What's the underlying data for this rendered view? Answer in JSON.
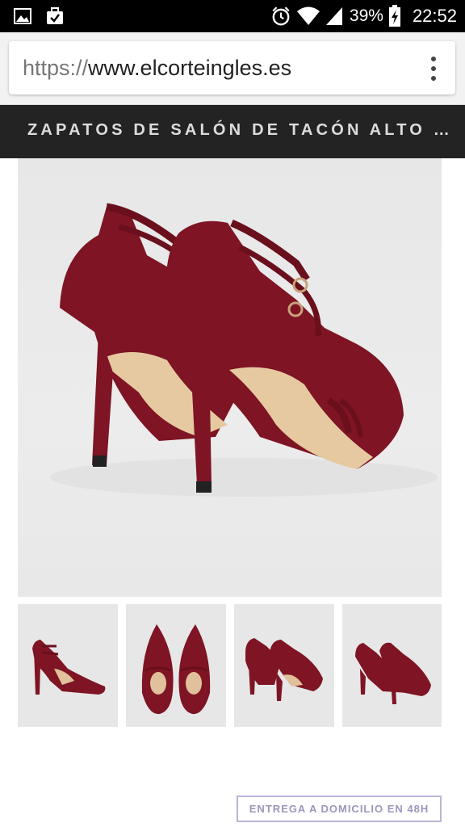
{
  "status_bar": {
    "battery_percent": "39%",
    "time": "22:52",
    "icons": [
      "image-icon",
      "task-bag-icon",
      "alarm-icon",
      "wifi-icon",
      "signal-icon",
      "battery-charging-icon"
    ]
  },
  "browser": {
    "url_scheme": "https://",
    "url_host": "www.elcorteingles.es",
    "menu_icon": "overflow-menu-icon"
  },
  "product": {
    "title": "ZAPATOS DE SALÓN DE TACÓN ALTO …",
    "main_image": "burgundy suede high-heel pumps with T-strap, rear view",
    "thumbnails": [
      "side view",
      "top view",
      "rear view",
      "front three-quarter view"
    ],
    "delivery_label": "ENTREGA A DOMICILIO EN 48H"
  },
  "colors": {
    "shoe": "#7e1424",
    "title_bar_bg": "#232323",
    "delivery_border": "#b9b6d6"
  }
}
